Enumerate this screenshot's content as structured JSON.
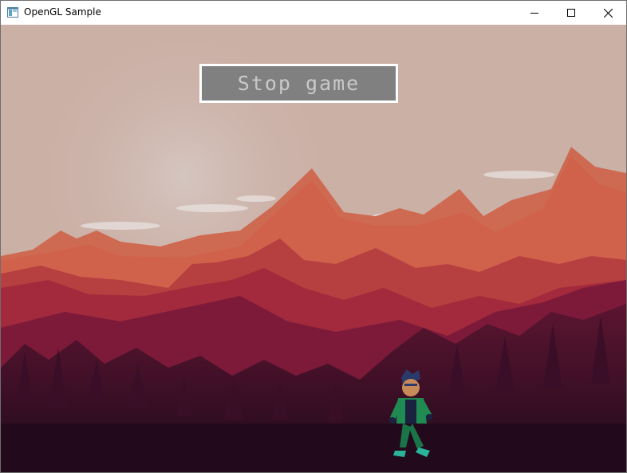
{
  "window": {
    "title": "OpenGL Sample",
    "controls": {
      "minimize": "minimize",
      "maximize": "maximize",
      "close": "close"
    }
  },
  "game": {
    "stop_button_label": "Stop game"
  },
  "colors": {
    "sky": "#cbb0a6",
    "button_bg": "#808080",
    "button_border": "#ffffff",
    "button_text": "#c9c9c9",
    "forest_dark": "#2a0c1e"
  },
  "icons": [
    "app-window-icon",
    "minimize-icon",
    "maximize-icon",
    "close-icon"
  ]
}
